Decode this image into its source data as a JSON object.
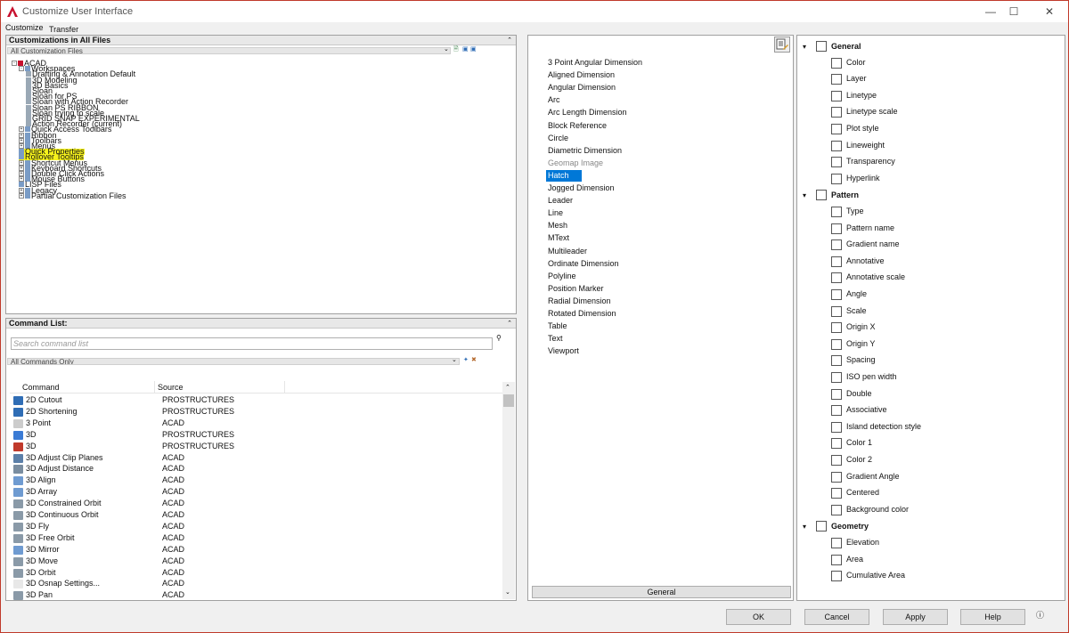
{
  "window": {
    "title": "Customize User Interface",
    "minimize": "—",
    "maximize": "☐",
    "close": "✕"
  },
  "tabs": {
    "customize": "Customize",
    "transfer": "Transfer"
  },
  "customizations": {
    "header": "Customizations in All Files",
    "filter": "All Customization Files",
    "tree": [
      {
        "label": "ACAD",
        "level": 0,
        "exp": "-"
      },
      {
        "label": "Workspaces",
        "level": 1,
        "exp": "-"
      },
      {
        "label": "Drafting & Annotation Default",
        "level": 2
      },
      {
        "label": "3D Modeling",
        "level": 2
      },
      {
        "label": "3D Basics",
        "level": 2
      },
      {
        "label": "Sloan",
        "level": 2
      },
      {
        "label": "Sloan for PS",
        "level": 2
      },
      {
        "label": "Sloan with Action Recorder",
        "level": 2
      },
      {
        "label": "Sloan PS RIBBON",
        "level": 2
      },
      {
        "label": "Sloan trying to scale",
        "level": 2
      },
      {
        "label": "GRID SNAP EXPERIMENTAL",
        "level": 2
      },
      {
        "label": "Action Recorder (current)",
        "level": 2
      },
      {
        "label": "Quick Access Toolbars",
        "level": 1,
        "exp": "+"
      },
      {
        "label": "Ribbon",
        "level": 1,
        "exp": "+"
      },
      {
        "label": "Toolbars",
        "level": 1,
        "exp": "+"
      },
      {
        "label": "Menus",
        "level": 1,
        "exp": "+"
      },
      {
        "label": "Quick Properties",
        "level": 1,
        "highlight": true
      },
      {
        "label": "Rollover Tooltips",
        "level": 1,
        "highlight": true
      },
      {
        "label": "Shortcut Menus",
        "level": 1,
        "exp": "+"
      },
      {
        "label": "Keyboard Shortcuts",
        "level": 1,
        "exp": "+"
      },
      {
        "label": "Double Click Actions",
        "level": 1,
        "exp": "+"
      },
      {
        "label": "Mouse Buttons",
        "level": 1,
        "exp": "+"
      },
      {
        "label": "LISP Files",
        "level": 1
      },
      {
        "label": "Legacy",
        "level": 1,
        "exp": "+"
      },
      {
        "label": "Partial Customization Files",
        "level": 1,
        "exp": "+"
      }
    ]
  },
  "command_list": {
    "header": "Command List:",
    "search_placeholder": "Search command list",
    "filter": "All Commands Only",
    "columns": [
      "Command",
      "Source"
    ],
    "rows": [
      {
        "name": "2D Cutout",
        "source": "PROSTRUCTURES",
        "color": "#2f6db5"
      },
      {
        "name": "2D Shortening",
        "source": "PROSTRUCTURES",
        "color": "#2f6db5"
      },
      {
        "name": "3 Point",
        "source": "ACAD",
        "color": "#cccccc"
      },
      {
        "name": "3D",
        "source": "PROSTRUCTURES",
        "color": "#3a7bd5"
      },
      {
        "name": "3D",
        "source": "PROSTRUCTURES",
        "color": "#c0392b"
      },
      {
        "name": "3D Adjust Clip Planes",
        "source": "ACAD",
        "color": "#5b7fa8"
      },
      {
        "name": "3D Adjust Distance",
        "source": "ACAD",
        "color": "#7a8da0"
      },
      {
        "name": "3D Align",
        "source": "ACAD",
        "color": "#6f9bd1"
      },
      {
        "name": "3D Array",
        "source": "ACAD",
        "color": "#6f9bd1"
      },
      {
        "name": "3D Constrained Orbit",
        "source": "ACAD",
        "color": "#8a9aa8"
      },
      {
        "name": "3D Continuous Orbit",
        "source": "ACAD",
        "color": "#8a9aa8"
      },
      {
        "name": "3D Fly",
        "source": "ACAD",
        "color": "#8a9aa8"
      },
      {
        "name": "3D Free Orbit",
        "source": "ACAD",
        "color": "#8a9aa8"
      },
      {
        "name": "3D Mirror",
        "source": "ACAD",
        "color": "#6f9bd1"
      },
      {
        "name": "3D Move",
        "source": "ACAD",
        "color": "#8a9aa8"
      },
      {
        "name": "3D Orbit",
        "source": "ACAD",
        "color": "#8a9aa8"
      },
      {
        "name": "3D Osnap Settings...",
        "source": "ACAD",
        "color": "#e8e8e8"
      },
      {
        "name": "3D Pan",
        "source": "ACAD",
        "color": "#8a9aa8"
      }
    ]
  },
  "object_types": {
    "items": [
      "3 Point Angular Dimension",
      "Aligned Dimension",
      "Angular Dimension",
      "Arc",
      "Arc Length Dimension",
      "Block Reference",
      "Circle",
      "Diametric Dimension",
      "Geomap Image",
      "Hatch",
      "Jogged Dimension",
      "Leader",
      "Line",
      "Mesh",
      "MText",
      "Multileader",
      "Ordinate Dimension",
      "Polyline",
      "Position Marker",
      "Radial Dimension",
      "Rotated Dimension",
      "Table",
      "Text",
      "Viewport"
    ],
    "selected": "Hatch",
    "disabled": "Geomap Image",
    "general_button": "General"
  },
  "properties": {
    "sections": [
      {
        "name": "General",
        "items": [
          "Color",
          "Layer",
          "Linetype",
          "Linetype scale",
          "Plot style",
          "Lineweight",
          "Transparency",
          "Hyperlink"
        ]
      },
      {
        "name": "Pattern",
        "items": [
          "Type",
          "Pattern name",
          "Gradient name",
          "Annotative",
          "Annotative scale",
          "Angle",
          "Scale",
          "Origin X",
          "Origin Y",
          "Spacing",
          "ISO pen width",
          "Double",
          "Associative",
          "Island detection style",
          "Color 1",
          "Color 2",
          "Gradient Angle",
          "Centered",
          "Background color"
        ]
      },
      {
        "name": "Geometry",
        "items": [
          "Elevation",
          "Area",
          "Cumulative Area"
        ]
      }
    ]
  },
  "buttons": {
    "ok": "OK",
    "cancel": "Cancel",
    "apply": "Apply",
    "help": "Help"
  }
}
